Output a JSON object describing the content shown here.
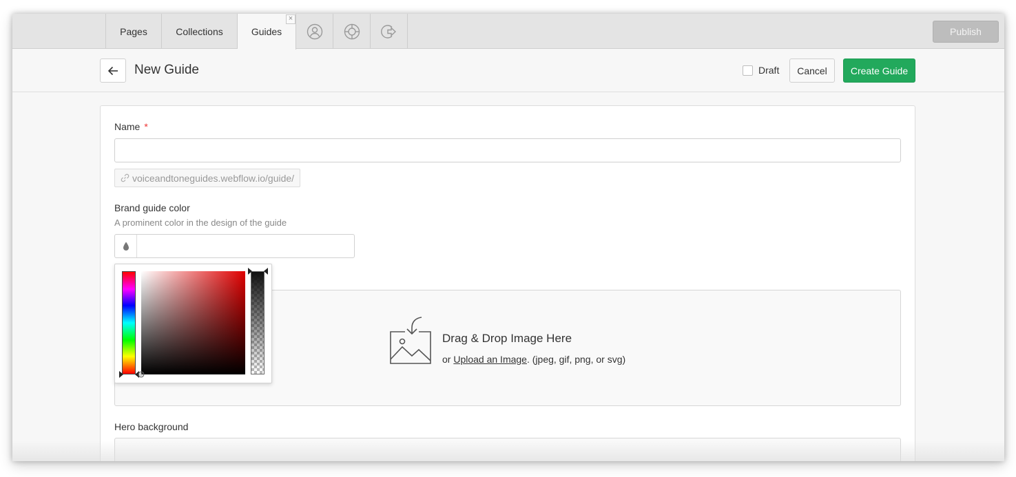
{
  "tabs": {
    "pages": "Pages",
    "collections": "Collections",
    "guides": "Guides"
  },
  "tab_icons": [
    "user-icon",
    "help-icon",
    "logout-icon"
  ],
  "topbar": {
    "publish_label": "Publish"
  },
  "header": {
    "title": "New Guide",
    "draft_label": "Draft",
    "draft_checked": false,
    "cancel_label": "Cancel",
    "create_label": "Create Guide"
  },
  "form": {
    "name_label": "Name",
    "required_mark": "*",
    "name_value": "",
    "slug_text": "voiceandtoneguides.webflow.io/guide/",
    "color_label": "Brand guide color",
    "color_hint": "A prominent color in the design of the guide",
    "color_value": "",
    "drop_title": "Drag & Drop Image Here",
    "drop_or": "or ",
    "drop_link": "Upload an Image",
    "drop_formats": ". (jpeg, gif, png, or svg)",
    "hero_label": "Hero background"
  },
  "colors": {
    "accent": "#22a95c",
    "publish_disabled": "#bdbdbd",
    "required": "#ee3333"
  }
}
